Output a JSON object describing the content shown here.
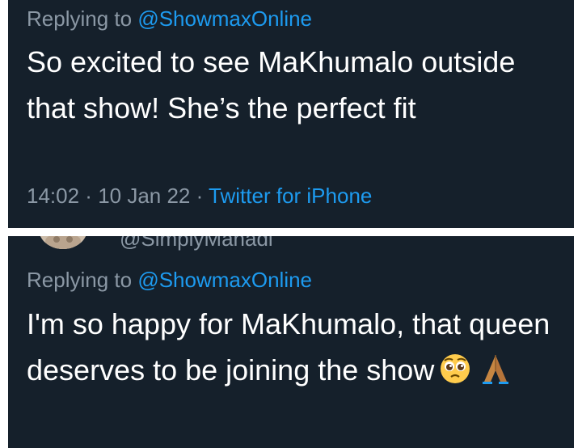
{
  "tweet1": {
    "replying_prefix": "Replying to ",
    "replying_handle": "@ShowmaxOnline",
    "text": "So excited to see MaKhumalo outside that show! She’s the perfect fit",
    "time": "14:02",
    "sep1": " · ",
    "date": "10 Jan 22",
    "sep2": " · ",
    "source": "Twitter for iPhone"
  },
  "tweet2": {
    "handle_partial": "@SimplyManadi",
    "replying_prefix": "Replying to ",
    "replying_handle": "@ShowmaxOnline",
    "text": "I'm so happy for MaKhumalo, that queen deserves to be joining the show",
    "emojis": [
      "pleading-face",
      "folded-hands"
    ]
  },
  "colors": {
    "background": "#15202b",
    "secondary_text": "#8b98a5",
    "primary_text": "#ffffff",
    "link": "#1d9bf0"
  }
}
